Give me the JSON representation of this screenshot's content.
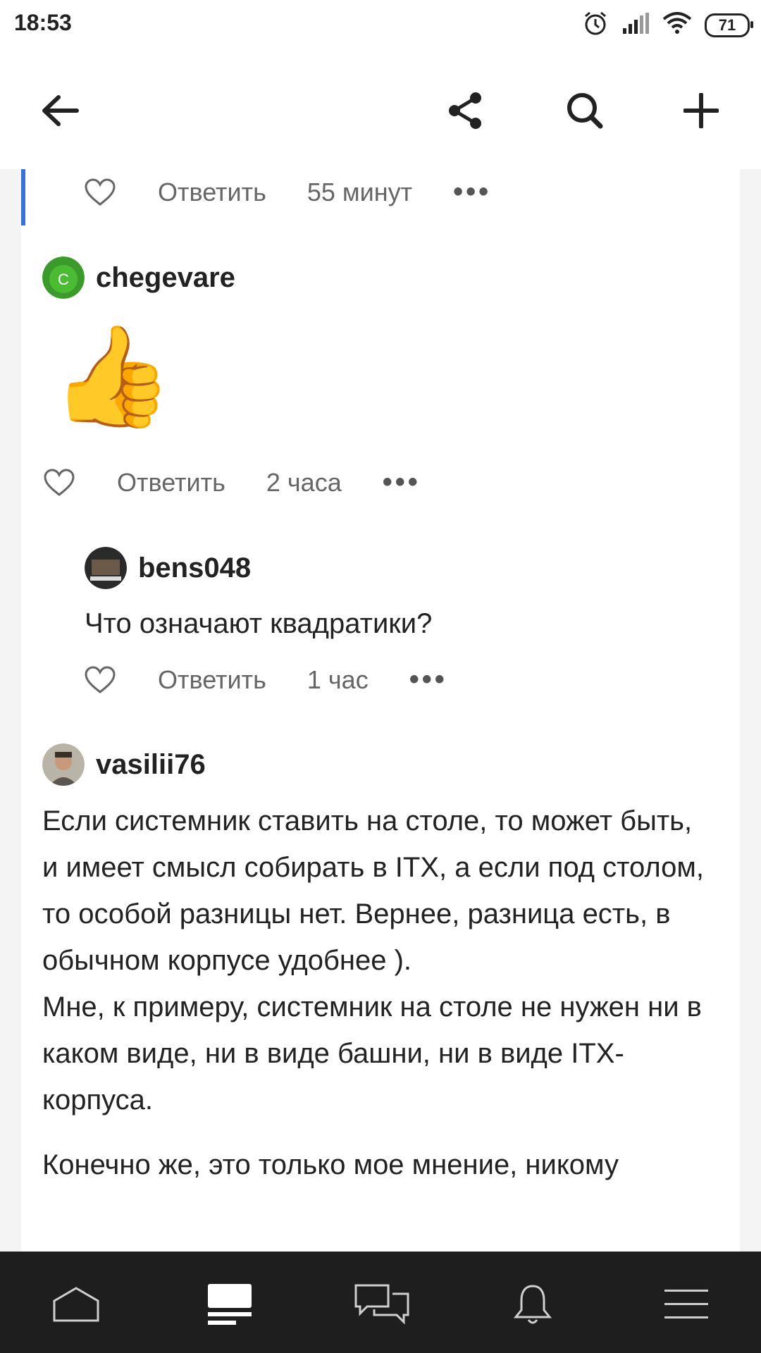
{
  "status_bar": {
    "time": "18:53",
    "battery": "71",
    "icons": [
      "alarm-icon",
      "signal-icon",
      "wifi-icon",
      "battery-icon"
    ]
  },
  "app_bar": {
    "icons": [
      "back-arrow-icon",
      "share-icon",
      "search-icon",
      "plus-icon"
    ]
  },
  "comments": [
    {
      "actions": {
        "reply_label": "Ответить",
        "time": "55 минут",
        "more": "•••"
      }
    },
    {
      "username": "chegevare",
      "avatar_letter": "C",
      "emoji": "👍",
      "actions": {
        "reply_label": "Ответить",
        "time": "2 часа",
        "more": "•••"
      }
    },
    {
      "username": "bens048",
      "text": "Что означают квадратики?",
      "actions": {
        "reply_label": "Ответить",
        "time": "1 час",
        "more": "•••"
      }
    },
    {
      "username": "vasilii76",
      "paragraphs": [
        "Если системник ставить на столе, то может быть, и имеет смысл собирать в ITX, а если под столом, то особой разницы нет. Вернее, разница есть, в обычном корпусе удобнее ).",
        "Мне, к примеру, системник на столе не нужен ни в каком виде, ни в виде башни, ни в виде ITX-корпуса.",
        "Конечно же, это только мое мнение, никому"
      ]
    }
  ],
  "bottom_nav": {
    "items": [
      "home-icon",
      "feed-icon",
      "chat-icon",
      "bell-icon",
      "menu-icon"
    ]
  },
  "colors": {
    "accent": "#3b6fd1",
    "nav_bg": "#1e1e1e",
    "text": "#222222",
    "muted": "#666666"
  }
}
